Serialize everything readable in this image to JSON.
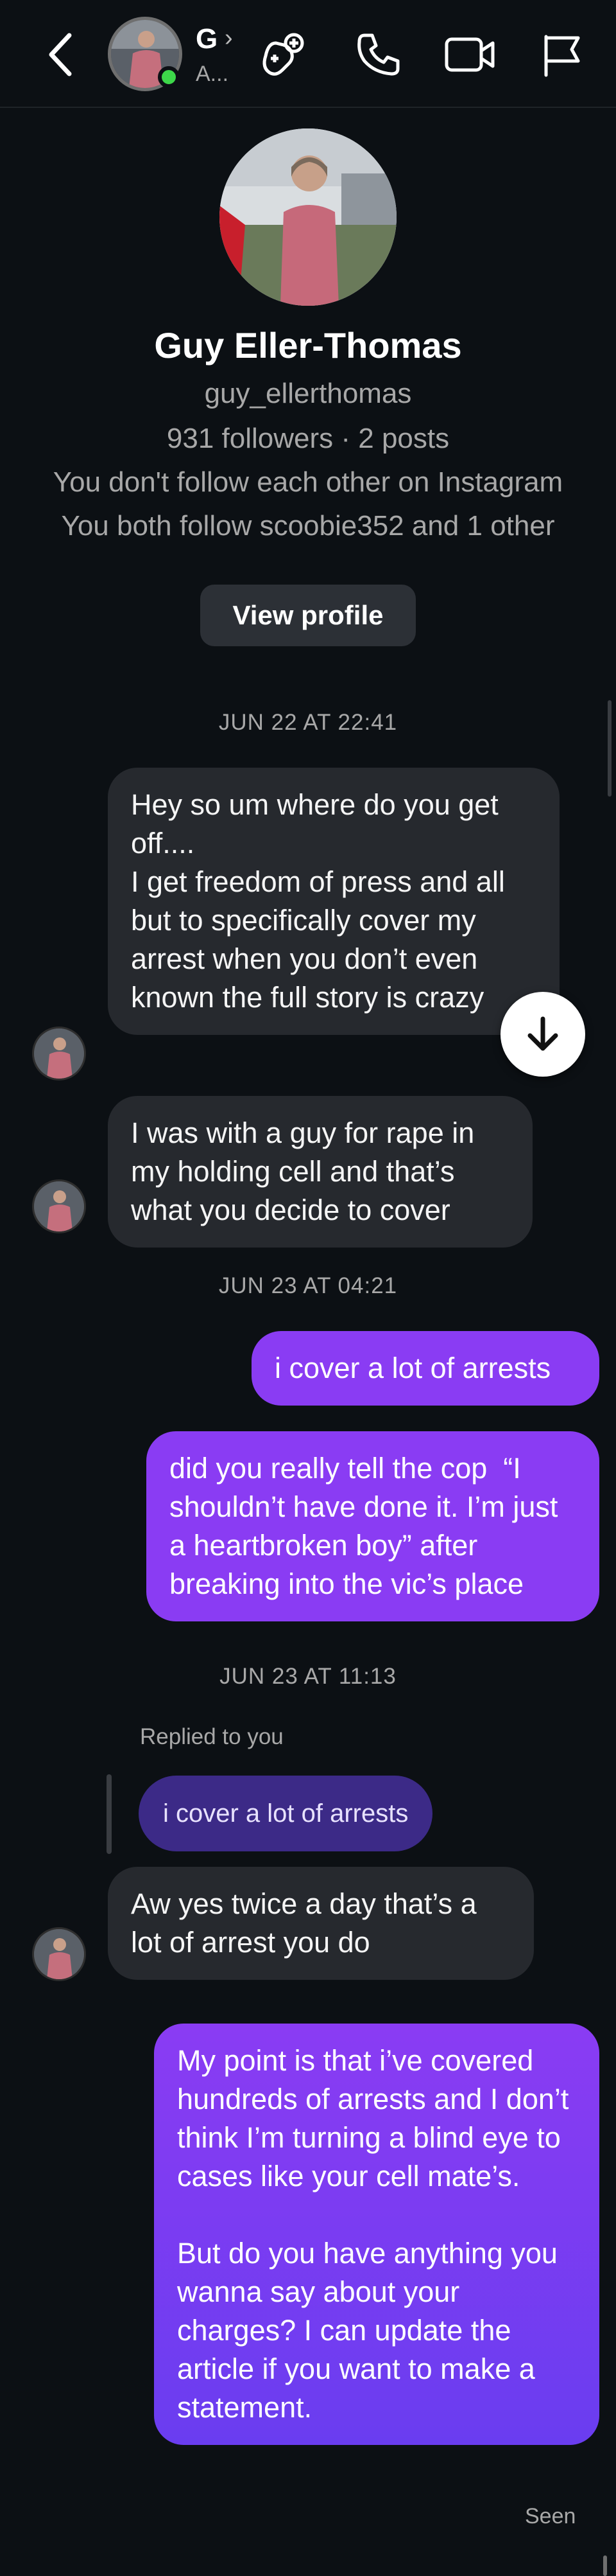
{
  "header": {
    "name_initial": "G",
    "status": "A...",
    "icons": [
      "back-arrow-icon",
      "games-icon",
      "phone-icon",
      "video-call-icon",
      "flag-icon"
    ]
  },
  "profile": {
    "name": "Guy Eller-Thomas",
    "username": "guy_ellerthomas",
    "stats": "931 followers · 2 posts",
    "follow_status": "You don't follow each other on Instagram",
    "mutuals": "You both follow scoobie352 and 1 other",
    "view_profile_label": "View profile"
  },
  "messages": {
    "ts1": "JUN 22 AT 22:41",
    "m1": "Hey so um where do you get off....\nI get freedom of press and all but to specifically cover my arrest when you don’t even known the full story is crazy",
    "m2": "I was with a guy for rape in my holding cell and that’s what you decide to cover",
    "ts2": "JUN 23 AT 04:21",
    "m3": "i cover a lot of arrests",
    "m4": "did you really tell the cop  “I shouldn’t have done it. I’m just a heartbroken boy” after breaking into the vic’s place",
    "ts3": "JUN 23 AT 11:13",
    "replied_label": "Replied to you",
    "reply_quote": "i cover a lot of arrests",
    "m5": "Aw yes twice a day that’s a lot of arrest you do",
    "m6": "My point is that i’ve covered hundreds of arrests and I don’t think I’m turning a blind eye to cases like your cell mate’s.\n\nBut do you have anything you wanna say about your charges? I can update the article if you want to make a statement.",
    "seen": "Seen"
  },
  "colors": {
    "background": "#0c1014",
    "incoming_bubble": "#26292e",
    "outgoing_bubble": "#8a3cf3",
    "reply_quote_bubble": "#3c2a87",
    "online_dot": "#3dd84a"
  }
}
